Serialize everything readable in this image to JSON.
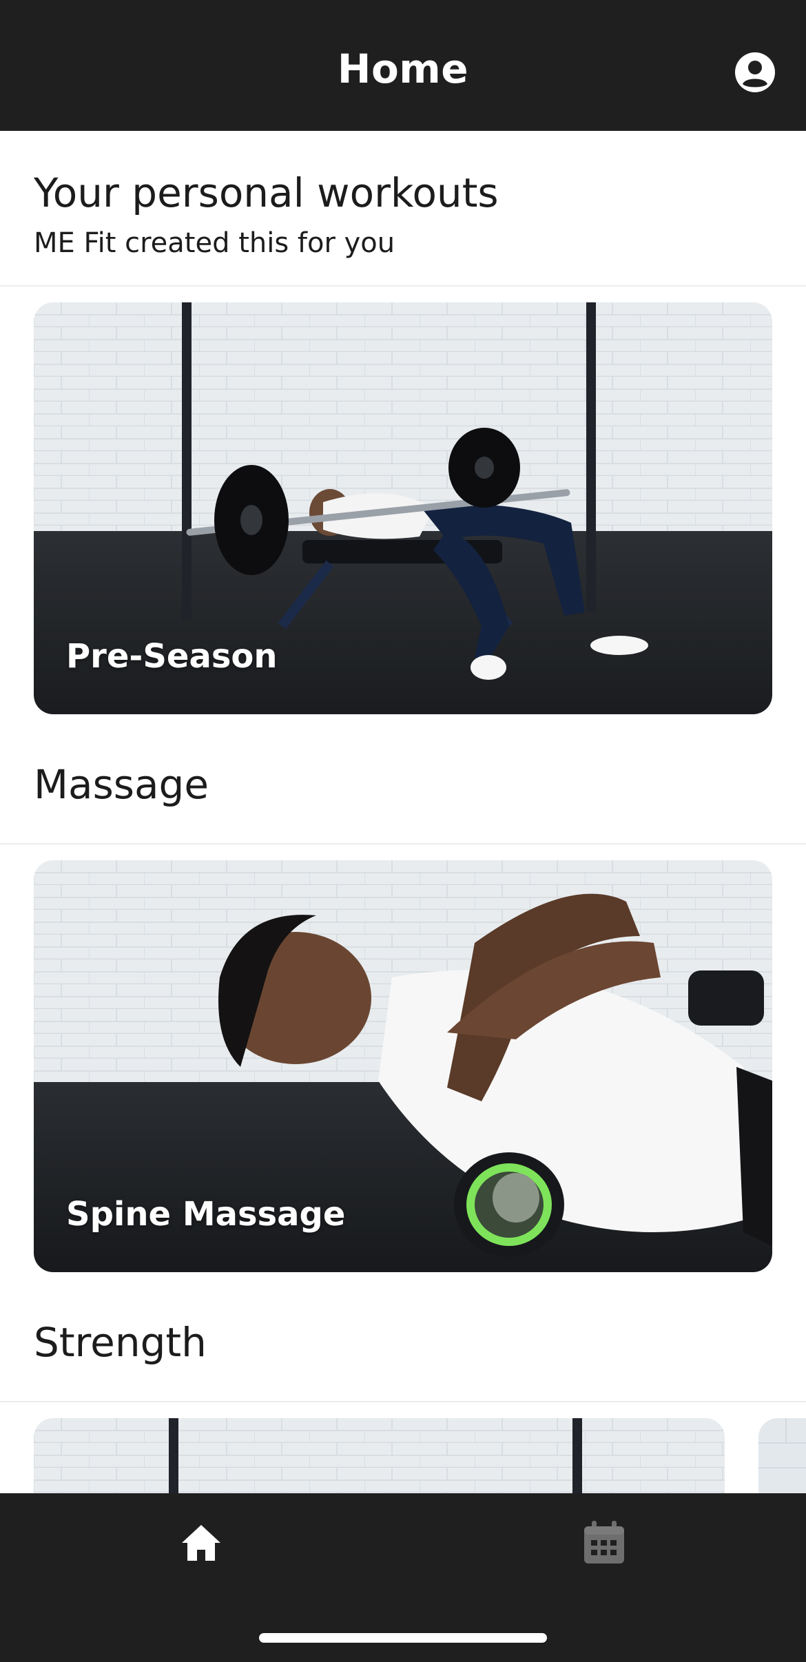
{
  "header": {
    "title": "Home",
    "profile_icon": "account-circle-icon"
  },
  "personal": {
    "heading": "Your personal workouts",
    "subheading": "ME Fit created this for you",
    "cards": [
      {
        "label": "Pre-Season"
      }
    ]
  },
  "massage": {
    "heading": "Massage",
    "cards": [
      {
        "label": "Spine Massage"
      }
    ]
  },
  "strength": {
    "heading": "Strength"
  },
  "bottom_nav": {
    "items": [
      {
        "icon": "home-icon",
        "active": true
      },
      {
        "icon": "calendar-icon",
        "active": false
      }
    ]
  },
  "colors": {
    "bar_background": "#1f1f1f",
    "accent_green": "#7ee35a",
    "inactive_icon": "#6e6e6e"
  }
}
